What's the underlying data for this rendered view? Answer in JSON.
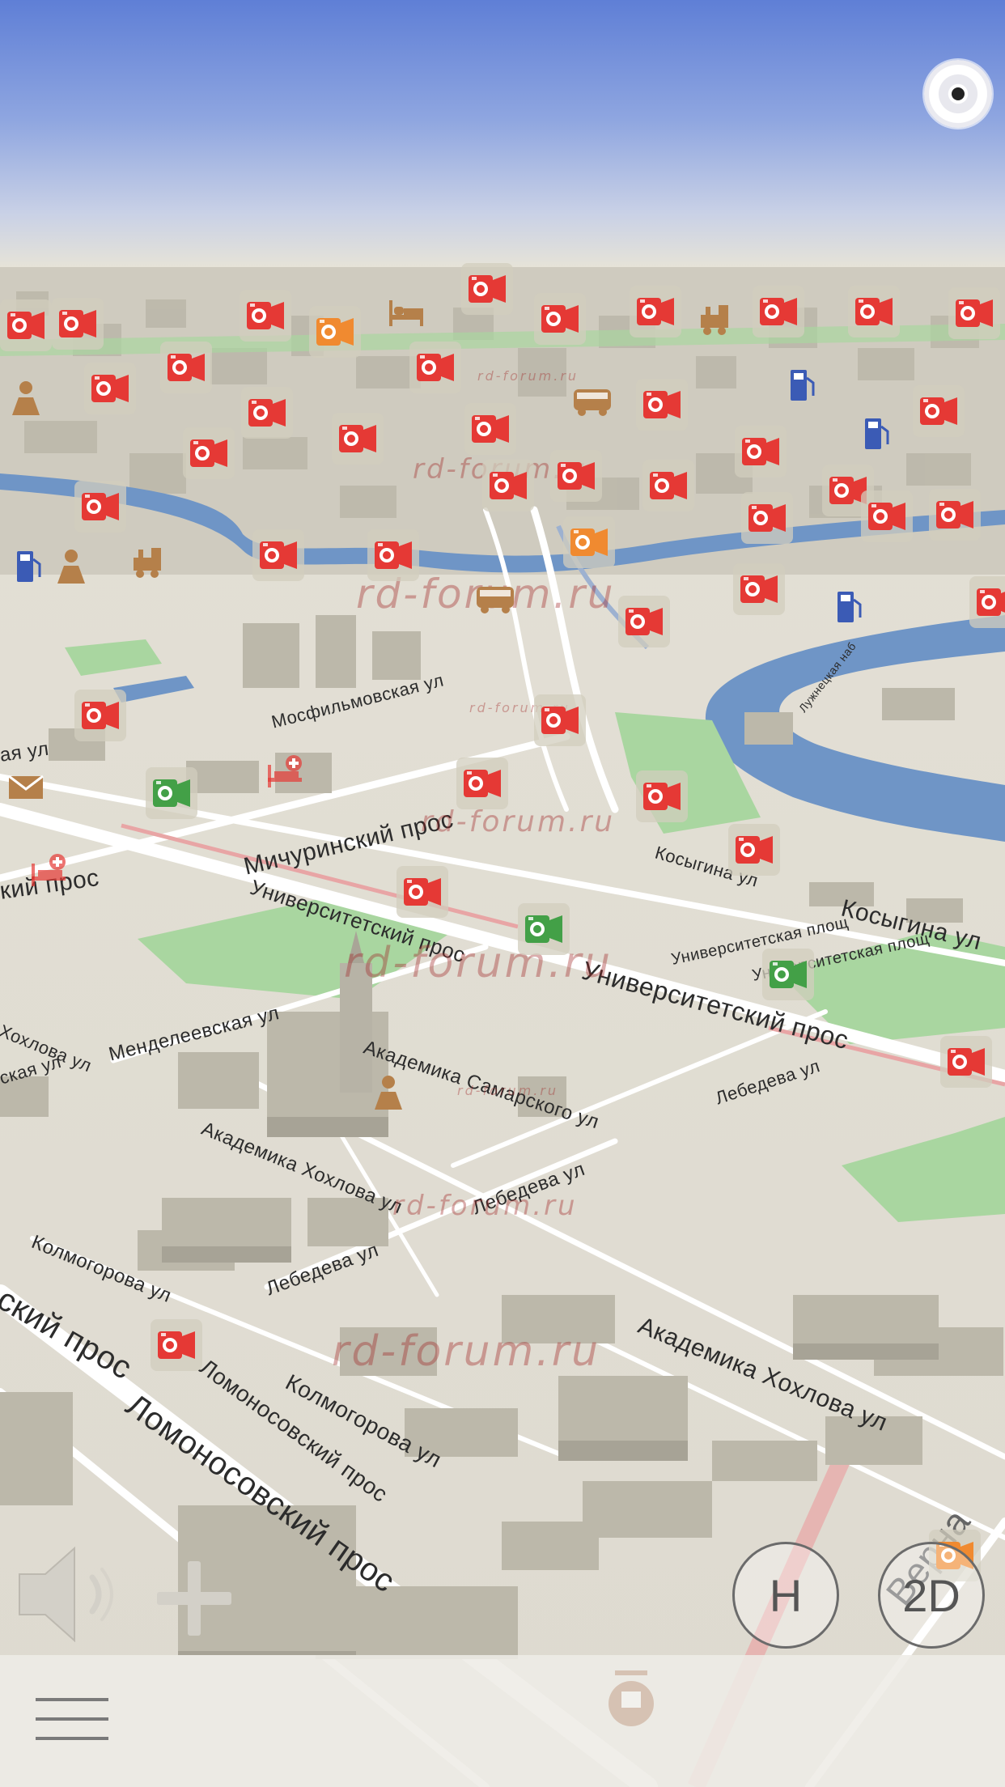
{
  "map": {
    "watermark": "rd-forum.ru",
    "streets": [
      {
        "id": "mosfilmovskaya",
        "label": "Мосфильмовская ул"
      },
      {
        "id": "michurinsky",
        "label": "Мичуринский прос"
      },
      {
        "id": "universitetsky-left",
        "label": "Университетский прос"
      },
      {
        "id": "universitetsky-main",
        "label": "Университетский прос"
      },
      {
        "id": "kosygina-short",
        "label": "Косыгина ул"
      },
      {
        "id": "kosygina",
        "label": "Косыгина ул"
      },
      {
        "id": "universitetskaya-ploshch-1",
        "label": "Университетская площ"
      },
      {
        "id": "universitetskaya-ploshch-2",
        "label": "Университетская площ"
      },
      {
        "id": "mendeleevskaya",
        "label": "Менделеевская ул"
      },
      {
        "id": "samarskogo",
        "label": "Академика Самарского ул"
      },
      {
        "id": "lebedeva-1",
        "label": "Лебедева ул"
      },
      {
        "id": "lebedeva-2",
        "label": "Лебедева ул"
      },
      {
        "id": "lebedeva-3",
        "label": "Лебедева ул"
      },
      {
        "id": "khokhlova-1",
        "label": "Академика Хохлова ул"
      },
      {
        "id": "khokhlova-2",
        "label": "Академика Хохлова ул"
      },
      {
        "id": "khokhlova-left",
        "label": "Хохлова ул"
      },
      {
        "id": "kolmogorova-1",
        "label": "Колмогорова ул"
      },
      {
        "id": "kolmogorova-2",
        "label": "Колмогорова ул"
      },
      {
        "id": "lomonosovsky-1",
        "label": "Ломоносовский прос"
      },
      {
        "id": "lomonosovsky-2",
        "label": "Ломоносовский прос"
      },
      {
        "id": "left-pros-1",
        "label": "кий прос"
      },
      {
        "id": "left-pros-2",
        "label": "ский прос"
      },
      {
        "id": "left-ul",
        "label": "ая ул"
      },
      {
        "id": "left-ul-2",
        "label": "ская ул"
      },
      {
        "id": "vernadskogo",
        "label": "Верна"
      },
      {
        "id": "kosmodamianskaya",
        "label": "Лужнецкая наб"
      }
    ]
  },
  "controls": {
    "volume_icon": "speaker-icon",
    "zoom_in_icon": "plus-icon",
    "heading_button_label": "H",
    "view_mode_button_label": "2D",
    "menu_icon": "hamburger-icon",
    "compass_icon": "compass-icon"
  },
  "colors": {
    "speed_camera": "#e53935",
    "camera_orange": "#f08a30",
    "camera_green": "#43a047",
    "fuel": "#3b5bb5",
    "poi_brown": "#b5804a",
    "water": "#6f95c6",
    "park": "#a9d6a0"
  }
}
